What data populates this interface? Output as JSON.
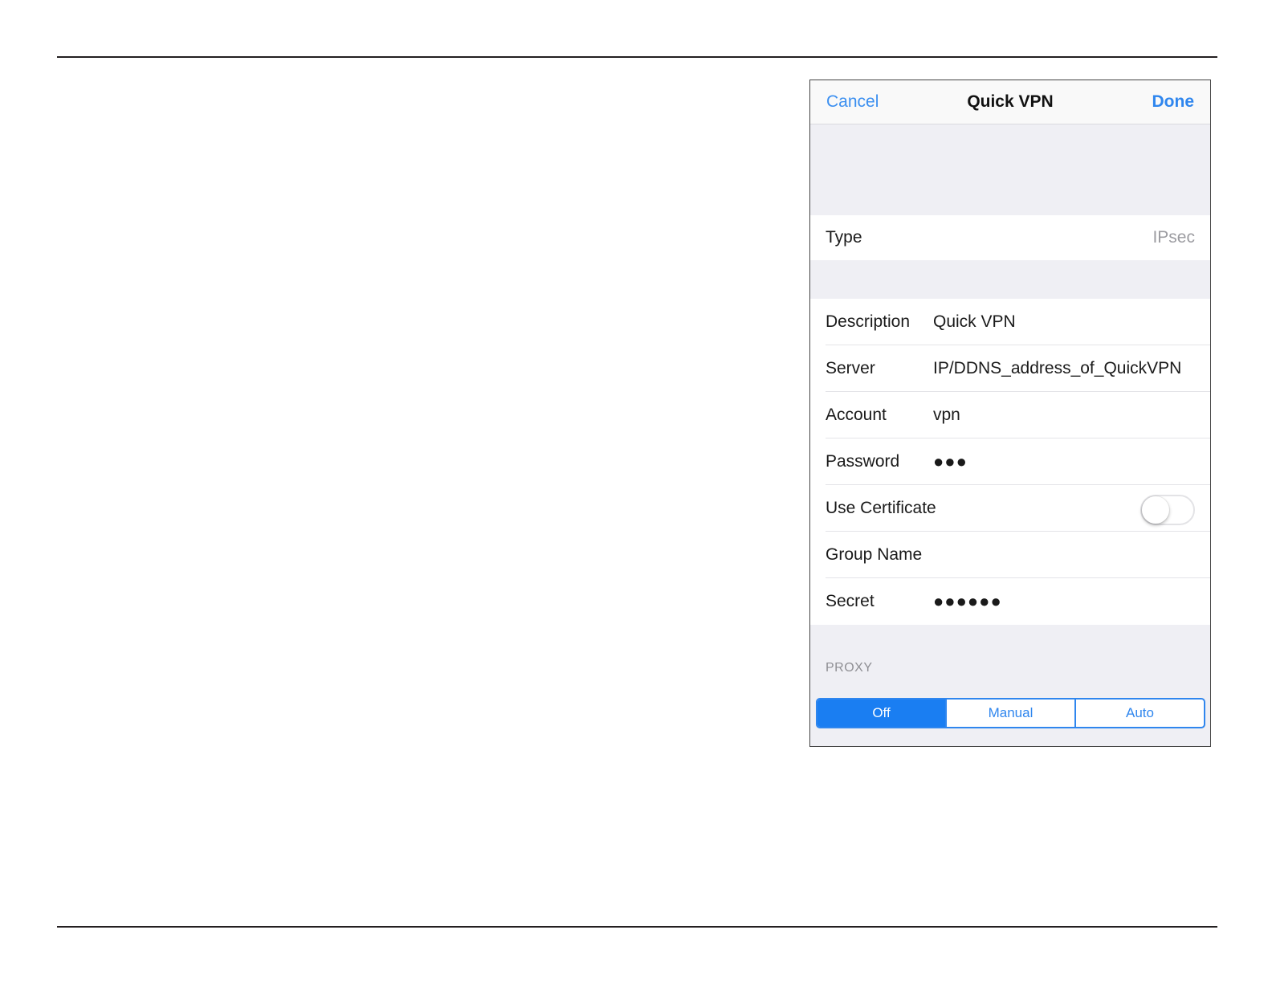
{
  "nav": {
    "cancel_label": "Cancel",
    "title": "Quick VPN",
    "done_label": "Done"
  },
  "type_row": {
    "label": "Type",
    "value": "IPsec"
  },
  "fields": {
    "description": {
      "label": "Description",
      "value": "Quick VPN"
    },
    "server": {
      "label": "Server",
      "value": "IP/DDNS_address_of_QuickVPN"
    },
    "account": {
      "label": "Account",
      "value": "vpn"
    },
    "password": {
      "label": "Password",
      "value": "●●●"
    },
    "use_certificate": {
      "label": "Use Certificate",
      "enabled": false
    },
    "group_name": {
      "label": "Group Name",
      "value": ""
    },
    "secret": {
      "label": "Secret",
      "value": "●●●●●●"
    }
  },
  "proxy": {
    "header": "PROXY",
    "options": [
      "Off",
      "Manual",
      "Auto"
    ],
    "selected": "Off"
  },
  "colors": {
    "accent": "#2f86ee",
    "segment_active": "#1a7ef2",
    "grouped_background": "#efeff4",
    "secondary_text": "#9c9ca1"
  }
}
